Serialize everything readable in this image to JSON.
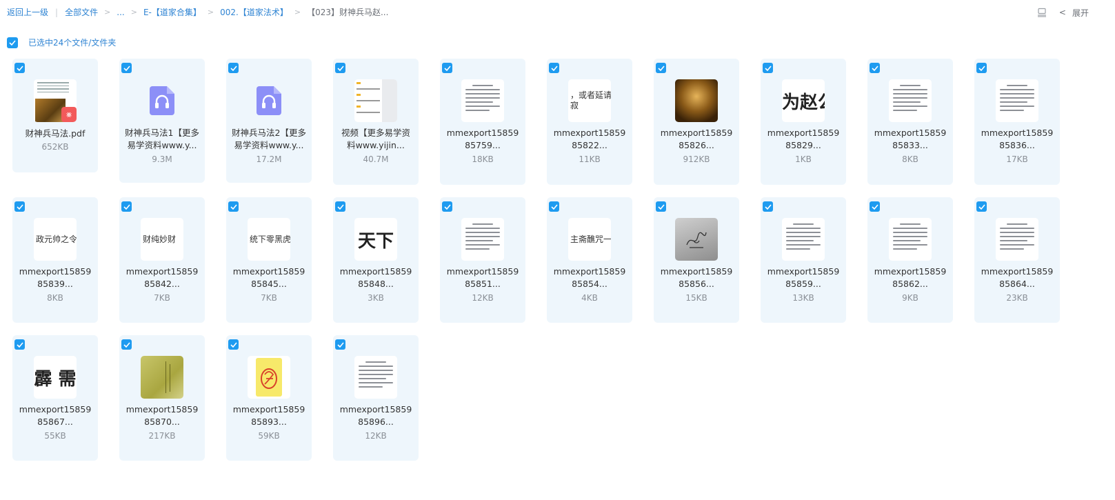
{
  "breadcrumb": {
    "back": "返回上一级",
    "all_files": "全部文件",
    "ellipsis": "...",
    "folder1": "E-【道家合集】",
    "folder2": "002.【道家法术】",
    "current": "【023】财神兵马赵..."
  },
  "toolbar": {
    "expand_label": "展开"
  },
  "selection": {
    "text": "已选中24个文件/文件夹"
  },
  "colors": {
    "accent": "#1e9bf0",
    "link": "#2f84d3",
    "card_bg": "#eef6fc"
  },
  "files": [
    {
      "name": "财神兵马法.pdf",
      "size": "652KB",
      "kind": "pdf"
    },
    {
      "name": "财神兵马法1【更多易学资料www.y...",
      "size": "9.3M",
      "kind": "audio"
    },
    {
      "name": "财神兵马法2【更多易学资料www.y...",
      "size": "17.2M",
      "kind": "audio"
    },
    {
      "name": "视频【更多易学资料www.yijin...",
      "size": "40.7M",
      "kind": "video"
    },
    {
      "name": "mmexport1585985759...",
      "size": "18KB",
      "kind": "doc"
    },
    {
      "name": "mmexport1585985822...",
      "size": "11KB",
      "kind": "text",
      "thumb_text": "，或者延请仙\n寂"
    },
    {
      "name": "mmexport1585985826...",
      "size": "912KB",
      "kind": "photo"
    },
    {
      "name": "mmexport1585985829...",
      "size": "1KB",
      "kind": "bigtext",
      "thumb_text": "为赵公"
    },
    {
      "name": "mmexport1585985833...",
      "size": "8KB",
      "kind": "doc"
    },
    {
      "name": "mmexport1585985836...",
      "size": "17KB",
      "kind": "doc"
    },
    {
      "name": "mmexport1585985839...",
      "size": "8KB",
      "kind": "text",
      "thumb_text": "政元帅之令。下"
    },
    {
      "name": "mmexport1585985842...",
      "size": "7KB",
      "kind": "text",
      "thumb_text": "财纯妙财"
    },
    {
      "name": "mmexport1585985845...",
      "size": "7KB",
      "kind": "text",
      "thumb_text": "统下零黑虎"
    },
    {
      "name": "mmexport1585985848...",
      "size": "3KB",
      "kind": "bigtext",
      "thumb_text": "天下"
    },
    {
      "name": "mmexport1585985851...",
      "size": "12KB",
      "kind": "doc"
    },
    {
      "name": "mmexport1585985854...",
      "size": "4KB",
      "kind": "text",
      "thumb_text": "主斋醮咒一链器。乡"
    },
    {
      "name": "mmexport1585985856...",
      "size": "15KB",
      "kind": "sketch"
    },
    {
      "name": "mmexport1585985859...",
      "size": "13KB",
      "kind": "doc"
    },
    {
      "name": "mmexport1585985862...",
      "size": "9KB",
      "kind": "doc"
    },
    {
      "name": "mmexport1585985864...",
      "size": "23KB",
      "kind": "doc"
    },
    {
      "name": "mmexport1585985867...",
      "size": "55KB",
      "kind": "bigtext",
      "thumb_text": "霹 需"
    },
    {
      "name": "mmexport1585985870...",
      "size": "217KB",
      "kind": "paper"
    },
    {
      "name": "mmexport1585985893...",
      "size": "59KB",
      "kind": "talisman"
    },
    {
      "name": "mmexport1585985896...",
      "size": "12KB",
      "kind": "doc"
    }
  ]
}
